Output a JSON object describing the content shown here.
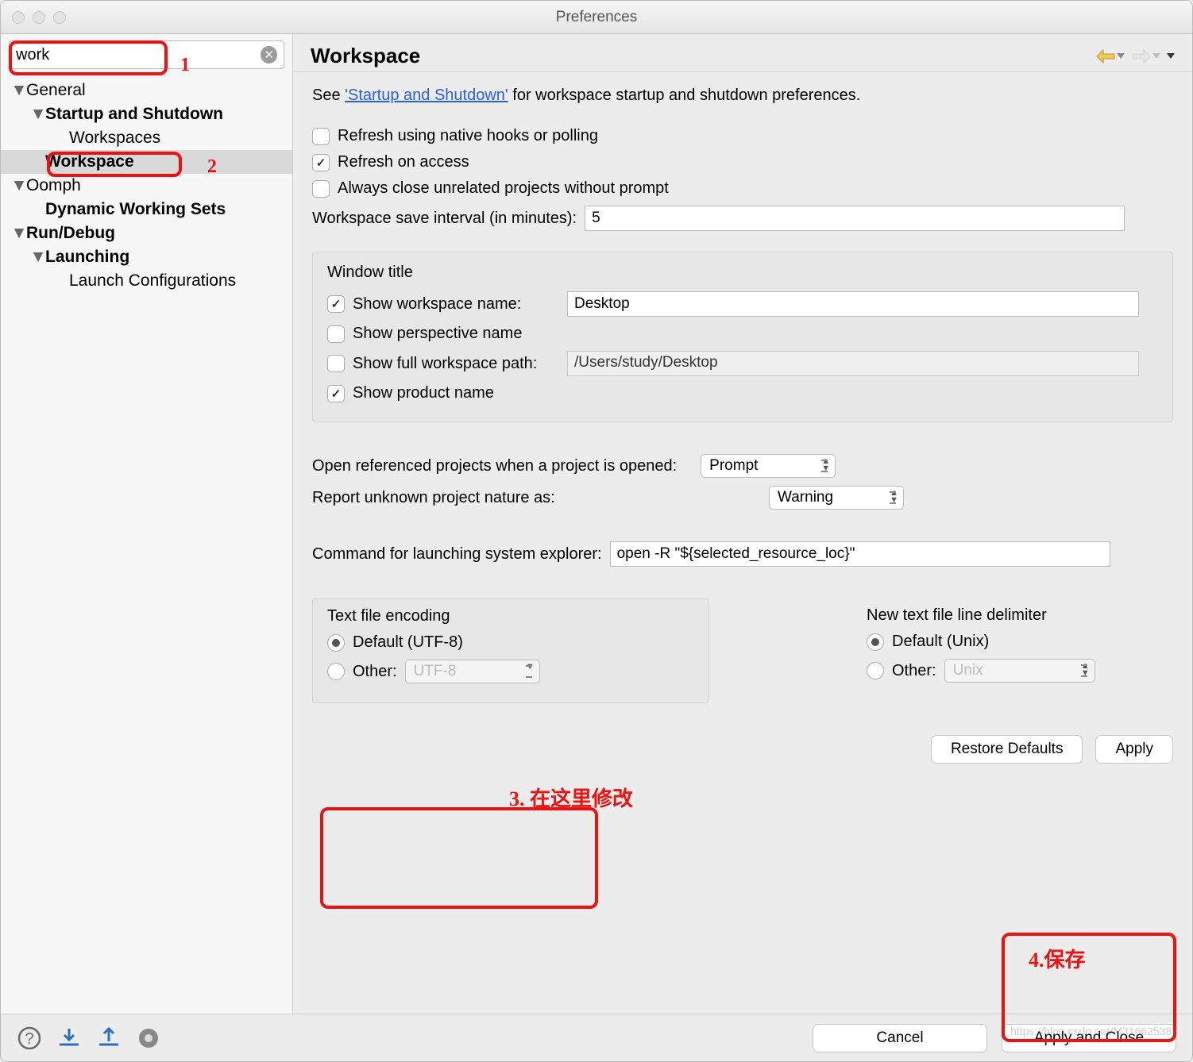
{
  "window": {
    "title": "Preferences"
  },
  "sidebar": {
    "search_value": "work",
    "items": [
      {
        "label": "General",
        "bold": false,
        "indent": 0,
        "disclosure": true
      },
      {
        "label": "Startup and Shutdown",
        "bold": true,
        "indent": 1,
        "disclosure": true
      },
      {
        "label": "Workspaces",
        "bold": false,
        "indent": 2,
        "disclosure": false
      },
      {
        "label": "Workspace",
        "bold": true,
        "indent": 1,
        "disclosure": false,
        "selected": true
      },
      {
        "label": "Oomph",
        "bold": false,
        "indent": 0,
        "disclosure": true
      },
      {
        "label": "Dynamic Working Sets",
        "bold": true,
        "indent": 1,
        "disclosure": false
      },
      {
        "label": "Run/Debug",
        "bold": true,
        "indent": 0,
        "disclosure": true
      },
      {
        "label": "Launching",
        "bold": true,
        "indent": 1,
        "disclosure": true
      },
      {
        "label": "Launch Configurations",
        "bold": false,
        "indent": 2,
        "disclosure": false
      }
    ]
  },
  "page": {
    "title": "Workspace",
    "intro_prefix": "See ",
    "intro_link": "'Startup and Shutdown'",
    "intro_suffix": " for workspace startup and shutdown preferences.",
    "refresh_native": {
      "label": "Refresh using native hooks or polling",
      "checked": false
    },
    "refresh_access": {
      "label": "Refresh on access",
      "checked": true
    },
    "close_unrelated": {
      "label": "Always close unrelated projects without prompt",
      "checked": false
    },
    "save_interval_label": "Workspace save interval (in minutes):",
    "save_interval_value": "5",
    "window_title_group": {
      "legend": "Window title",
      "show_workspace_name": {
        "label": "Show workspace name:",
        "checked": true,
        "value": "Desktop"
      },
      "show_perspective_name": {
        "label": "Show perspective name",
        "checked": false
      },
      "show_full_path": {
        "label": "Show full workspace path:",
        "checked": false,
        "value": "/Users/study/Desktop"
      },
      "show_product_name": {
        "label": "Show product name",
        "checked": true
      }
    },
    "open_referenced_label": "Open referenced projects when a project is opened:",
    "open_referenced_value": "Prompt",
    "report_unknown_label": "Report unknown project nature as:",
    "report_unknown_value": "Warning",
    "launch_explorer_label": "Command for launching system explorer:",
    "launch_explorer_value": "open -R \"${selected_resource_loc}\"",
    "encoding_group": {
      "legend": "Text file encoding",
      "default_label": "Default (UTF-8)",
      "default_selected": true,
      "other_label": "Other:",
      "other_value": "UTF-8"
    },
    "delimiter_group": {
      "legend": "New text file line delimiter",
      "default_label": "Default (Unix)",
      "default_selected": true,
      "other_label": "Other:",
      "other_value": "Unix"
    },
    "restore_defaults": "Restore Defaults",
    "apply": "Apply"
  },
  "footer": {
    "cancel": "Cancel",
    "apply_close": "Apply and Close"
  },
  "annotations": {
    "a1": "1",
    "a2": "2",
    "a3": "3. 在这里修改",
    "a4": "4.保存"
  },
  "watermark": "https://blog.csdn.net/M316625387"
}
